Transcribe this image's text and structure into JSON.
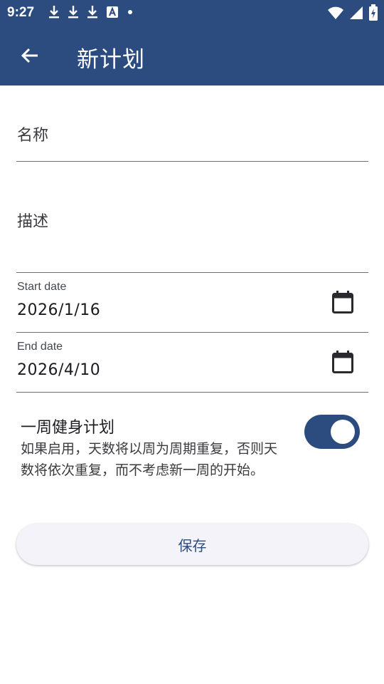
{
  "status_bar": {
    "time": "9:27",
    "notification_icons": [
      "download-icon",
      "download-icon",
      "download-icon",
      "text-a-icon",
      "dot-icon"
    ],
    "right_icons": [
      "wifi-icon",
      "signal-icon",
      "battery-charging-icon"
    ]
  },
  "app_bar": {
    "title": "新计划",
    "back_icon": "arrow-left-icon"
  },
  "form": {
    "name_placeholder": "名称",
    "description_placeholder": "描述",
    "start_date": {
      "label": "Start date",
      "value": "2026/1/16"
    },
    "end_date": {
      "label": "End date",
      "value": "2026/4/10"
    },
    "weekly_plan": {
      "title": "一周健身计划",
      "description": "如果启用，天数将以周为周期重复，否则天数将依次重复，而不考虑新一周的开始。",
      "enabled": true
    },
    "save_label": "保存"
  },
  "colors": {
    "primary": "#2c4c80",
    "button_bg": "#f3f3f9",
    "divider": "#6f6f73"
  }
}
